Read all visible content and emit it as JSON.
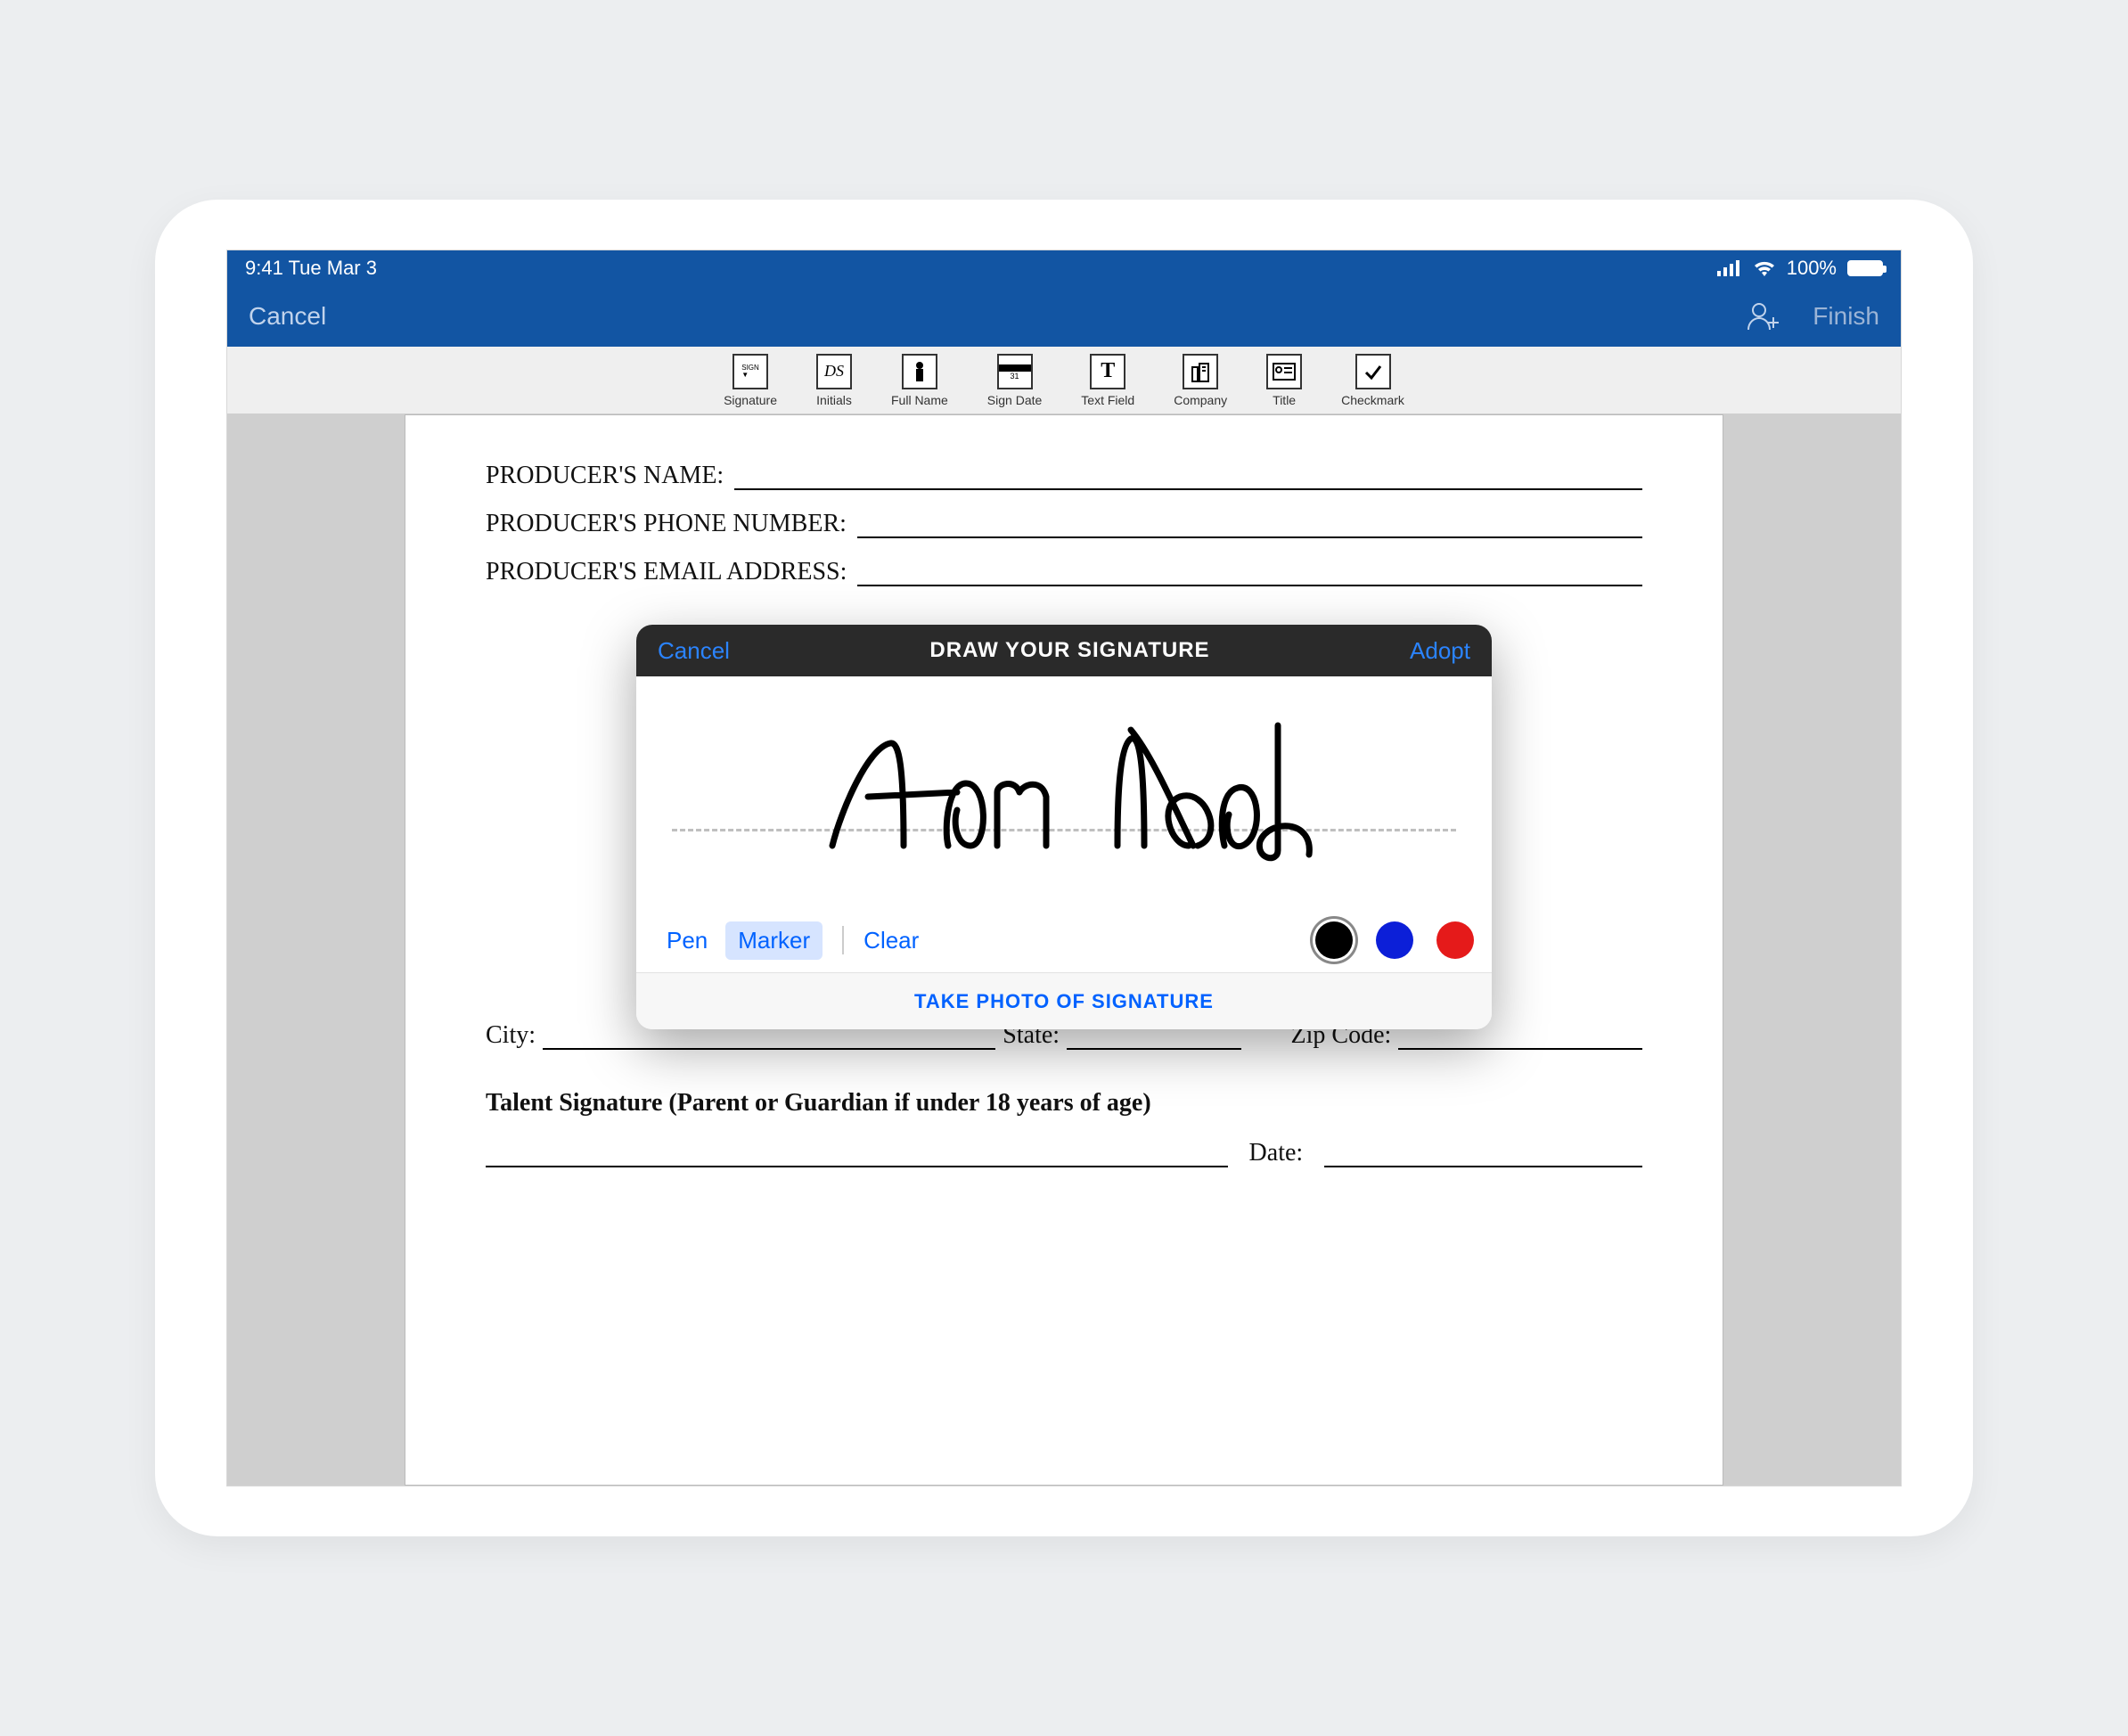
{
  "status": {
    "time": "9:41 Tue Mar 3",
    "battery_pct": "100%"
  },
  "nav": {
    "cancel": "Cancel",
    "finish": "Finish"
  },
  "toolbar": {
    "items": [
      {
        "label": "Signature",
        "icon": "SIGN"
      },
      {
        "label": "Initials",
        "icon": "DS"
      },
      {
        "label": "Full Name",
        "icon": "person"
      },
      {
        "label": "Sign Date",
        "icon": "31"
      },
      {
        "label": "Text Field",
        "icon": "T"
      },
      {
        "label": "Company",
        "icon": "building"
      },
      {
        "label": "Title",
        "icon": "id"
      },
      {
        "label": "Checkmark",
        "icon": "check"
      }
    ]
  },
  "document": {
    "fields": {
      "producer_name": "PRODUCER'S NAME:",
      "producer_phone": "PRODUCER'S PHONE NUMBER:",
      "producer_email": "PRODUCER'S EMAIL ADDRESS:",
      "city": "City:",
      "state": "State:",
      "zip": "Zip Code:",
      "signature_note": "Talent Signature (Parent or Guardian if under 18 years of age)",
      "date": "Date:"
    }
  },
  "signature_modal": {
    "cancel": "Cancel",
    "title": "DRAW YOUR SIGNATURE",
    "adopt": "Adopt",
    "pen": "Pen",
    "marker": "Marker",
    "clear": "Clear",
    "photo": "TAKE PHOTO OF SIGNATURE",
    "colors": {
      "black": "#000000",
      "blue": "#0c1fd8",
      "red": "#e51a1a"
    },
    "selected_color": "black",
    "selected_tool": "Marker"
  }
}
